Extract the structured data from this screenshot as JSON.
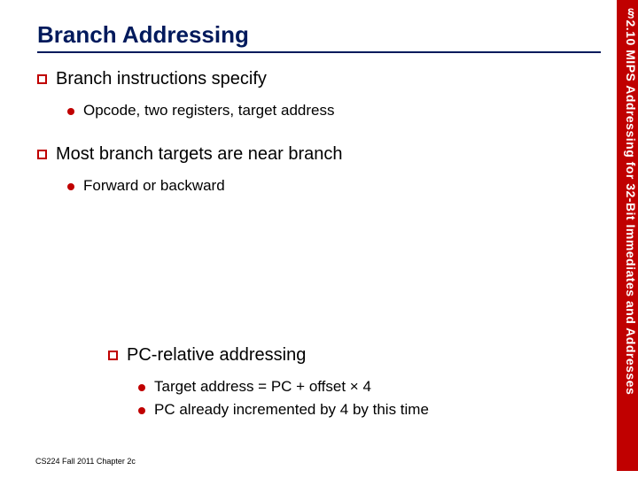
{
  "slide": {
    "title": "Branch Addressing",
    "footer": "CS224 Fall 2011 Chapter 2c",
    "sidebar_label": "§2.10 MIPS Addressing for 32-Bit Immediates and Addresses"
  },
  "bullets": {
    "b1": "Branch instructions specify",
    "b1a": "Opcode, two registers, target address",
    "b2": "Most branch targets are near branch",
    "b2a": "Forward or backward",
    "b3": "PC-relative addressing",
    "b3a": "Target address = PC + offset × 4",
    "b3b": "PC already incremented by 4 by this time"
  }
}
